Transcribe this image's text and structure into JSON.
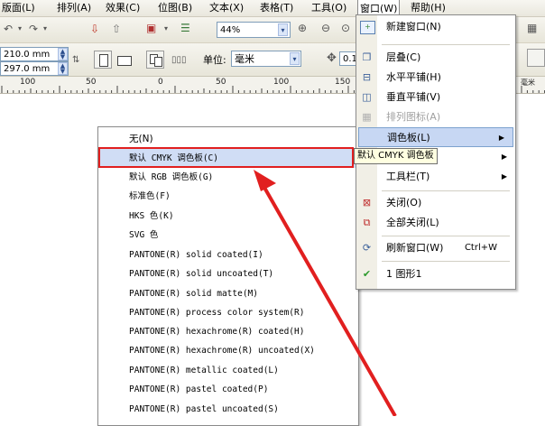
{
  "menubar": {
    "items": [
      "版面(L)",
      "排列(A)",
      "效果(C)",
      "位图(B)",
      "文本(X)",
      "表格(T)",
      "工具(O)",
      "窗口(W)",
      "帮助(H)"
    ]
  },
  "toolbar": {
    "zoom_value": "44%"
  },
  "property_bar": {
    "width_value": "210.0 mm",
    "height_value": "297.0 mm",
    "units_label": "单位:",
    "units_value": "毫米",
    "nudge_value": "0.1"
  },
  "ruler": {
    "labels": [
      "100",
      "50",
      "0",
      "50",
      "100",
      "150"
    ],
    "unit": "毫米"
  },
  "window_menu": {
    "items": [
      {
        "label": "新建窗口(N)",
        "icon": "new-window-icon"
      },
      {
        "label": "层叠(C)",
        "icon": "cascade-icon"
      },
      {
        "label": "水平平铺(H)",
        "icon": "tile-horizontal-icon"
      },
      {
        "label": "垂直平铺(V)",
        "icon": "tile-vertical-icon"
      },
      {
        "label": "排列图标(A)",
        "icon": "arrange-icons-icon",
        "disabled": true
      },
      {
        "label": "调色板(L)",
        "submenu": true,
        "highlighted": true
      },
      {
        "label": "",
        "submenu": true
      },
      {
        "label": "工具栏(T)",
        "submenu": true
      },
      {
        "label": "关闭(O)",
        "icon": "close-window-icon"
      },
      {
        "label": "全部关闭(L)",
        "icon": "close-all-icon"
      },
      {
        "label": "刷新窗口(W)",
        "icon": "refresh-window-icon",
        "shortcut": "Ctrl+W"
      },
      {
        "label": "1 图形1",
        "icon": "check-icon"
      }
    ]
  },
  "tooltip": "默认 CMYK 调色板",
  "palette_menu": {
    "items": [
      "无(N)",
      "默认 CMYK 调色板(C)",
      "默认 RGB 调色板(G)",
      "标准色(F)",
      "HKS 色(K)",
      "SVG 色",
      "PANTONE(R) solid coated(I)",
      "PANTONE(R) solid uncoated(T)",
      "PANTONE(R) solid matte(M)",
      "PANTONE(R) process color system(R)",
      "PANTONE(R) hexachrome(R) coated(H)",
      "PANTONE(R) hexachrome(R) uncoated(X)",
      "PANTONE(R) metallic coated(L)",
      "PANTONE(R) pastel coated(P)",
      "PANTONE(R) pastel uncoated(S)"
    ],
    "selected_index": 1
  },
  "colors": {
    "annotation_red": "#e11f1f",
    "highlight_blue": "#c7d7f3"
  }
}
